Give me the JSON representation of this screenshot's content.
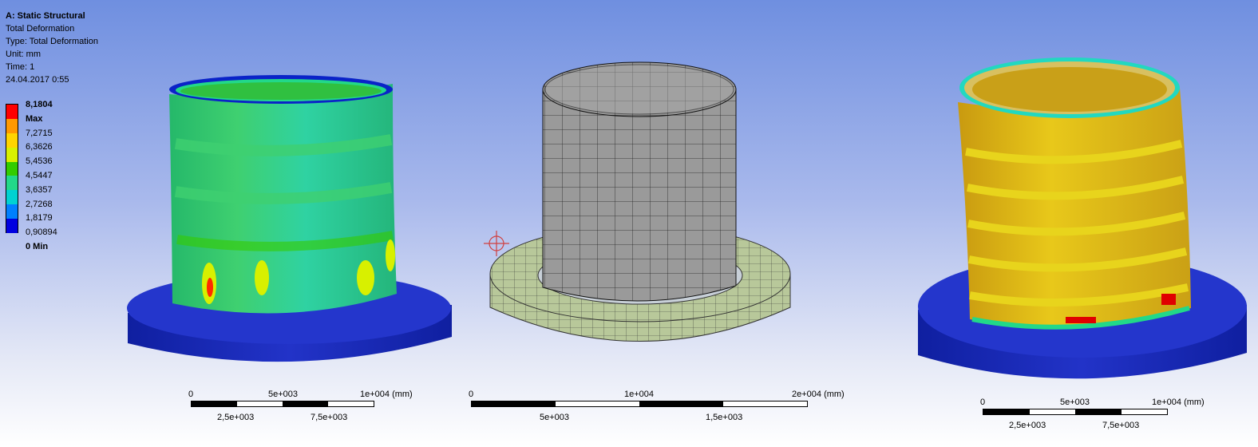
{
  "header": {
    "analysis": "A: Static Structural",
    "result": "Total Deformation",
    "type": "Type: Total Deformation",
    "unit": "Unit: mm",
    "time": "Time: 1",
    "date": "24.04.2017 0:55"
  },
  "legend": {
    "max_label": "8,1804 Max",
    "min_label": "0 Min",
    "values": [
      "7,2715",
      "6,3626",
      "5,4536",
      "4,5447",
      "3,6357",
      "2,7268",
      "1,8179",
      "0,90894"
    ],
    "colors": [
      "#ff0000",
      "#ff9900",
      "#ffd400",
      "#d8f000",
      "#33cc00",
      "#22d889",
      "#00d2d2",
      "#0080ff",
      "#0000e0"
    ]
  },
  "scale_left": {
    "top_labels": [
      "0",
      "5e+003",
      "1e+004 (mm)"
    ],
    "bottom_labels": [
      "2,5e+003",
      "7,5e+003"
    ]
  },
  "scale_middle": {
    "top_labels": [
      "0",
      "1e+004",
      "2e+004 (mm)"
    ],
    "bottom_labels": [
      "5e+003",
      "1,5e+003"
    ]
  },
  "scale_right": {
    "top_labels": [
      "0",
      "5e+003",
      "1e+004 (mm)"
    ],
    "bottom_labels": [
      "2,5e+003",
      "7,5e+003"
    ]
  }
}
